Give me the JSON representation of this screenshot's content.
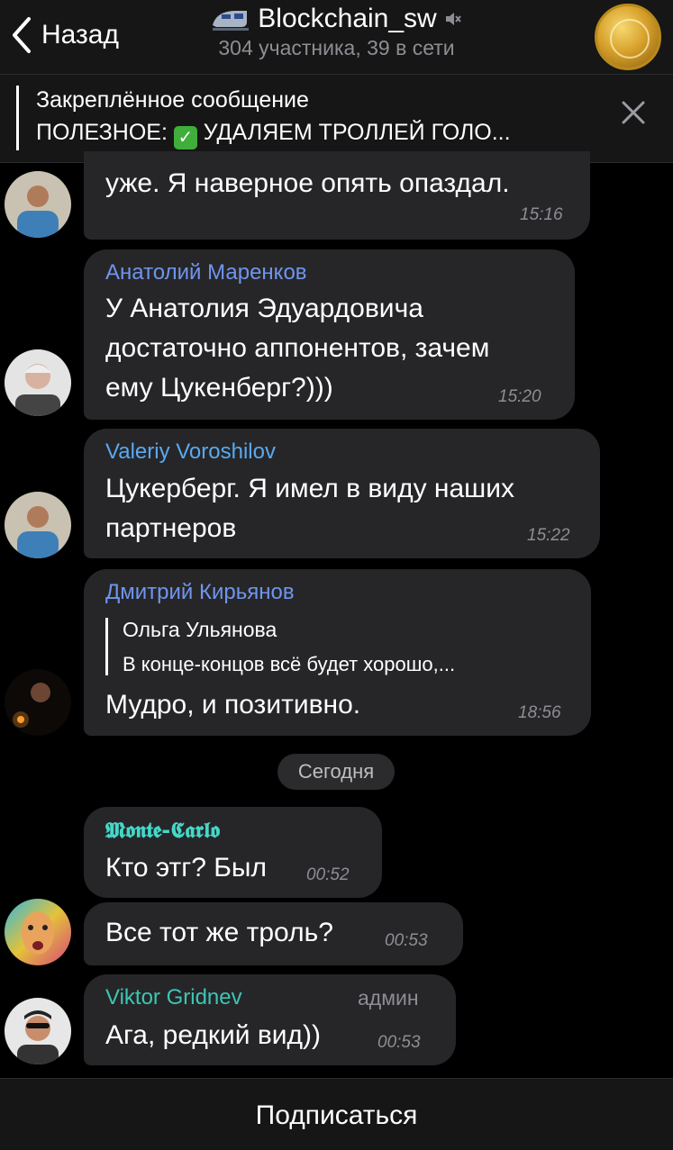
{
  "header": {
    "back_label": "Назад",
    "title": "Blockchain_sw",
    "subtitle": "304 участника, 39 в сети"
  },
  "pinned": {
    "title": "Закреплённое сообщение",
    "text": "ПОЛЕЗНОЕ: ✅ УДАЛЯЕМ ТРОЛЛЕЙ ГОЛО...",
    "text_prefix": "ПОЛЕЗНОЕ:",
    "text_suffix": "УДАЛЯЕМ ТРОЛЛЕЙ ГОЛО..."
  },
  "messages": [
    {
      "text": "уже. Я наверное опять опаздал.",
      "time": "15:16"
    },
    {
      "sender": "Анатолий Маренков",
      "sender_color": "#6f95ee",
      "lines": [
        "У Анатолия Эдуардовича",
        "достаточно аппонентов, зачем",
        "ему Цукенберг?)))"
      ],
      "time": "15:20"
    },
    {
      "sender": "Valeriy Voroshilov",
      "sender_color": "#5aa9f0",
      "lines": [
        "Цукерберг. Я имел в виду наших",
        "партнеров"
      ],
      "time": "15:22"
    },
    {
      "sender": "Дмитрий Кирьянов",
      "sender_color": "#6f95ee",
      "reply_name": "Ольга Ульянова",
      "reply_text": "В конце-концов всё будет хорошо,...",
      "text": "Мудро, и позитивно.",
      "time": "18:56"
    },
    {
      "sender": "𝕸𝖔𝖓𝖙𝖊-𝕮𝖆𝖗𝖑𝖔",
      "sender_color": "#45d7c8",
      "text": "Кто этг? Был",
      "time": "00:52"
    },
    {
      "text": "Все тот же троль?",
      "time": "00:53"
    },
    {
      "sender": "Viktor Gridnev",
      "sender_color": "#3cc6b5",
      "badge": "админ",
      "text": "Ага, редкий вид))",
      "time": "00:53"
    }
  ],
  "date_separator": "Сегодня",
  "bottom": {
    "subscribe_label": "Подписаться"
  }
}
